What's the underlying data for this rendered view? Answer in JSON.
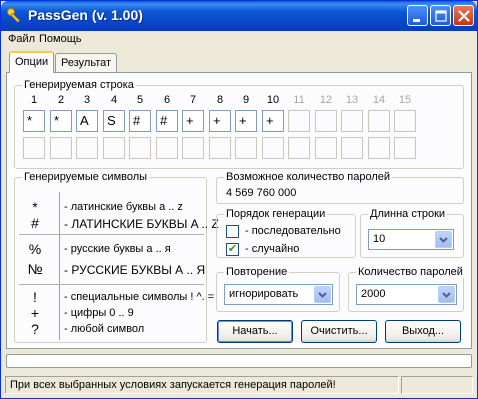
{
  "window": {
    "title": "PassGen (v. 1.00)",
    "title_bar_color": "#0a57d6",
    "icons": [
      "key-icon",
      "minimize-icon",
      "maximize-icon",
      "close-icon"
    ]
  },
  "menu": {
    "file": "Файл",
    "help": "Помощь"
  },
  "tabs": [
    {
      "label": "Опции",
      "active": true
    },
    {
      "label": "Результат",
      "active": false
    }
  ],
  "generated_string": {
    "legend": "Генерируемая строка",
    "positions": [
      "1",
      "2",
      "3",
      "4",
      "5",
      "6",
      "7",
      "8",
      "9",
      "10",
      "11",
      "12",
      "13",
      "14",
      "15"
    ],
    "active_count": 10,
    "row1": [
      "*",
      "*",
      "A",
      "S",
      "#",
      "#",
      "+",
      "+",
      "+",
      "+",
      "",
      "",
      "",
      "",
      ""
    ],
    "row2": [
      "",
      "",
      "",
      "",
      "",
      "",
      "",
      "",
      "",
      "",
      "",
      "",
      "",
      "",
      ""
    ]
  },
  "charset": {
    "legend": "Генерируемые символы",
    "items": [
      {
        "symbol": "*",
        "label": "- латинские буквы a .. z"
      },
      {
        "symbol": "#",
        "label": "- ЛАТИНСКИЕ БУКВЫ A .. Z"
      },
      {
        "symbol": "%",
        "label": "- русские буквы а .. я"
      },
      {
        "symbol": "№",
        "label": "- РУССКИЕ БУКВЫ А .. Я"
      },
      {
        "symbol": "!",
        "label": "- специальные символы ! ^. ="
      },
      {
        "symbol": "+",
        "label": "- цифры 0 .. 9"
      },
      {
        "symbol": "?",
        "label": "- любой символ"
      }
    ]
  },
  "possible": {
    "legend": "Возможное количество паролей",
    "value": "4 569 760 000"
  },
  "order": {
    "legend": "Порядок генерации",
    "sequential_label": "- последовательно",
    "sequential_checked": false,
    "random_label": "- случайно",
    "random_checked": true,
    "check_mark": "✔"
  },
  "length": {
    "legend": "Длинна строки",
    "value": "10"
  },
  "repeat": {
    "legend": "Повторение",
    "value": "игнорировать"
  },
  "count": {
    "legend": "Количество паролей",
    "value": "2000"
  },
  "buttons": {
    "start": "Начать...",
    "clear": "Очистить...",
    "exit": "Выход..."
  },
  "status": {
    "text": "При всех выбранных условиях запускается генерация паролей!",
    "progress": 0
  }
}
